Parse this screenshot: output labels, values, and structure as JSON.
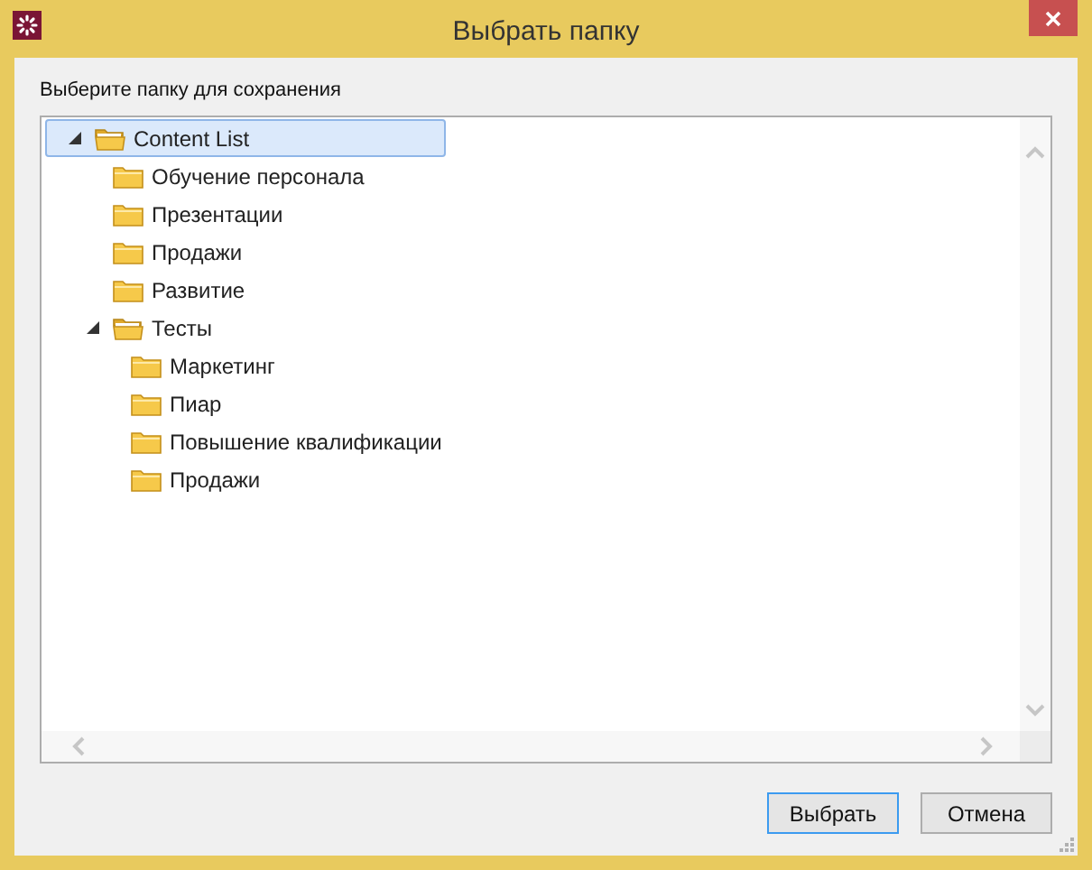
{
  "window": {
    "title": "Выбрать папку"
  },
  "prompt": "Выберите папку для сохранения",
  "tree": [
    {
      "label": "Content List",
      "expanded": true,
      "selected": true,
      "children": [
        {
          "label": "Обучение персонала",
          "selected": false
        },
        {
          "label": "Презентации",
          "selected": false
        },
        {
          "label": "Продажи",
          "selected": false
        },
        {
          "label": "Развитие",
          "selected": false
        },
        {
          "label": "Тесты",
          "expanded": true,
          "selected": false,
          "children": [
            {
              "label": "Маркетинг",
              "selected": false
            },
            {
              "label": "Пиар",
              "selected": false
            },
            {
              "label": "Повышение квалификации",
              "selected": false
            },
            {
              "label": "Продажи",
              "selected": false
            }
          ]
        }
      ]
    }
  ],
  "buttons": [
    {
      "label": "Выбрать",
      "default": true
    },
    {
      "label": "Отмена",
      "default": false
    }
  ]
}
